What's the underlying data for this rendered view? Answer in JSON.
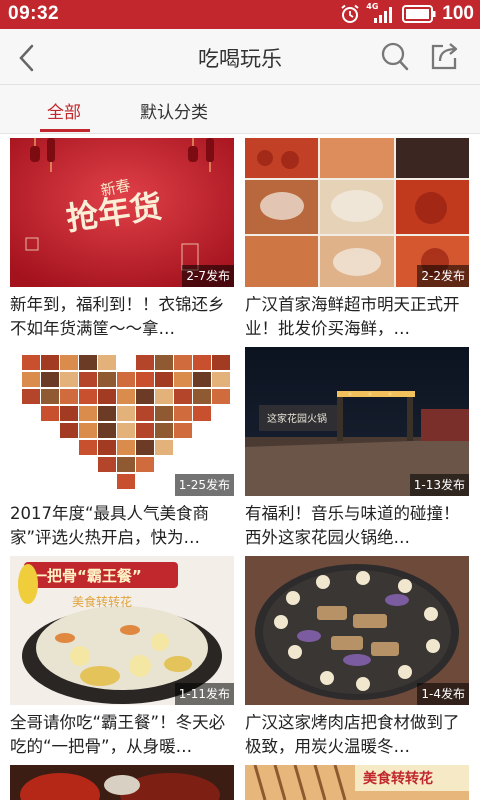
{
  "status_bar": {
    "time": "09:32",
    "network": "4G",
    "battery": "100",
    "color": "#c1272d"
  },
  "header": {
    "title": "吃喝玩乐",
    "back_icon": "back-arrow-icon",
    "search_icon": "search-icon",
    "share_icon": "share-icon"
  },
  "tabs": [
    {
      "label": "全部",
      "active": true
    },
    {
      "label": "默认分类",
      "active": false
    }
  ],
  "accent_color": "#c1272d",
  "cards": [
    {
      "image": "new-year-shopping-banner",
      "image_text": "抢年货",
      "image_small": "新春",
      "badge": "2-7发布",
      "title": "新年到，福利到！！衣锦还乡不如年货满筐～～拿…"
    },
    {
      "image": "seafood-collage",
      "badge": "2-2发布",
      "title": "广汉首家海鲜超市明天正式开业！批发价买海鲜，…"
    },
    {
      "image": "food-heart-collage",
      "badge": "1-25发布",
      "title": "2017年度“最具人气美食商家”评选火热开启，快为…"
    },
    {
      "image": "hotpot-garden-night",
      "sign_text": "这家花园火锅",
      "badge": "1-13发布",
      "title": "有福利！音乐与味道的碰撞！西外这家花园火锅绝…"
    },
    {
      "image": "bone-soup-pot",
      "image_text": "一把骨“霸王餐”",
      "image_small": "美食转转花",
      "badge": "1-11发布",
      "title": "全哥请你吃“霸王餐”！冬天必吃的“一把骨”，从身暖…"
    },
    {
      "image": "bbq-grill-plate",
      "badge": "1-4发布",
      "title": "广汉这家烤肉店把食材做到了极致，用炭火温暖冬…"
    },
    {
      "image": "spicy-dishes-partial",
      "badge": "",
      "title": ""
    },
    {
      "image": "skewers-partial",
      "image_text": "美食转转花",
      "badge": "",
      "title": ""
    }
  ]
}
